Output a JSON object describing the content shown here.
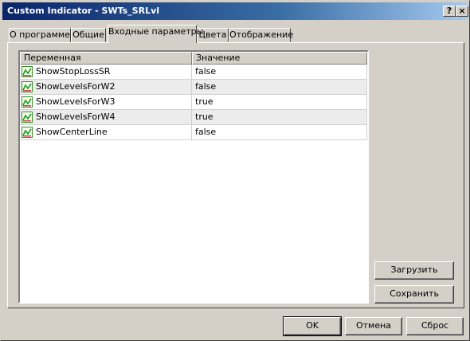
{
  "window": {
    "title": "Custom Indicator - SWTs_SRLvl",
    "help_label": "?",
    "close_label": "×"
  },
  "tabs": [
    {
      "label": "О программе"
    },
    {
      "label": "Общие"
    },
    {
      "label": "Входные параметры"
    },
    {
      "label": "Цвета"
    },
    {
      "label": "Отображение"
    }
  ],
  "active_tab": "Входные параметры",
  "table": {
    "headers": [
      "Переменная",
      "Значение"
    ],
    "rows": [
      {
        "name": "ShowStopLossSR",
        "value": "false",
        "icon": "parameter-icon"
      },
      {
        "name": "ShowLevelsForW2",
        "value": "false",
        "icon": "parameter-icon"
      },
      {
        "name": "ShowLevelsForW3",
        "value": "true",
        "icon": "parameter-icon"
      },
      {
        "name": "ShowLevelsForW4",
        "value": "true",
        "icon": "parameter-icon"
      },
      {
        "name": "ShowCenterLine",
        "value": "false",
        "icon": "parameter-icon"
      }
    ]
  },
  "side_buttons": {
    "load_label": "Загрузить",
    "save_label": "Сохранить"
  },
  "footer_buttons": {
    "ok_label": "OK",
    "cancel_label": "Отмена",
    "reset_label": "Сброс"
  }
}
